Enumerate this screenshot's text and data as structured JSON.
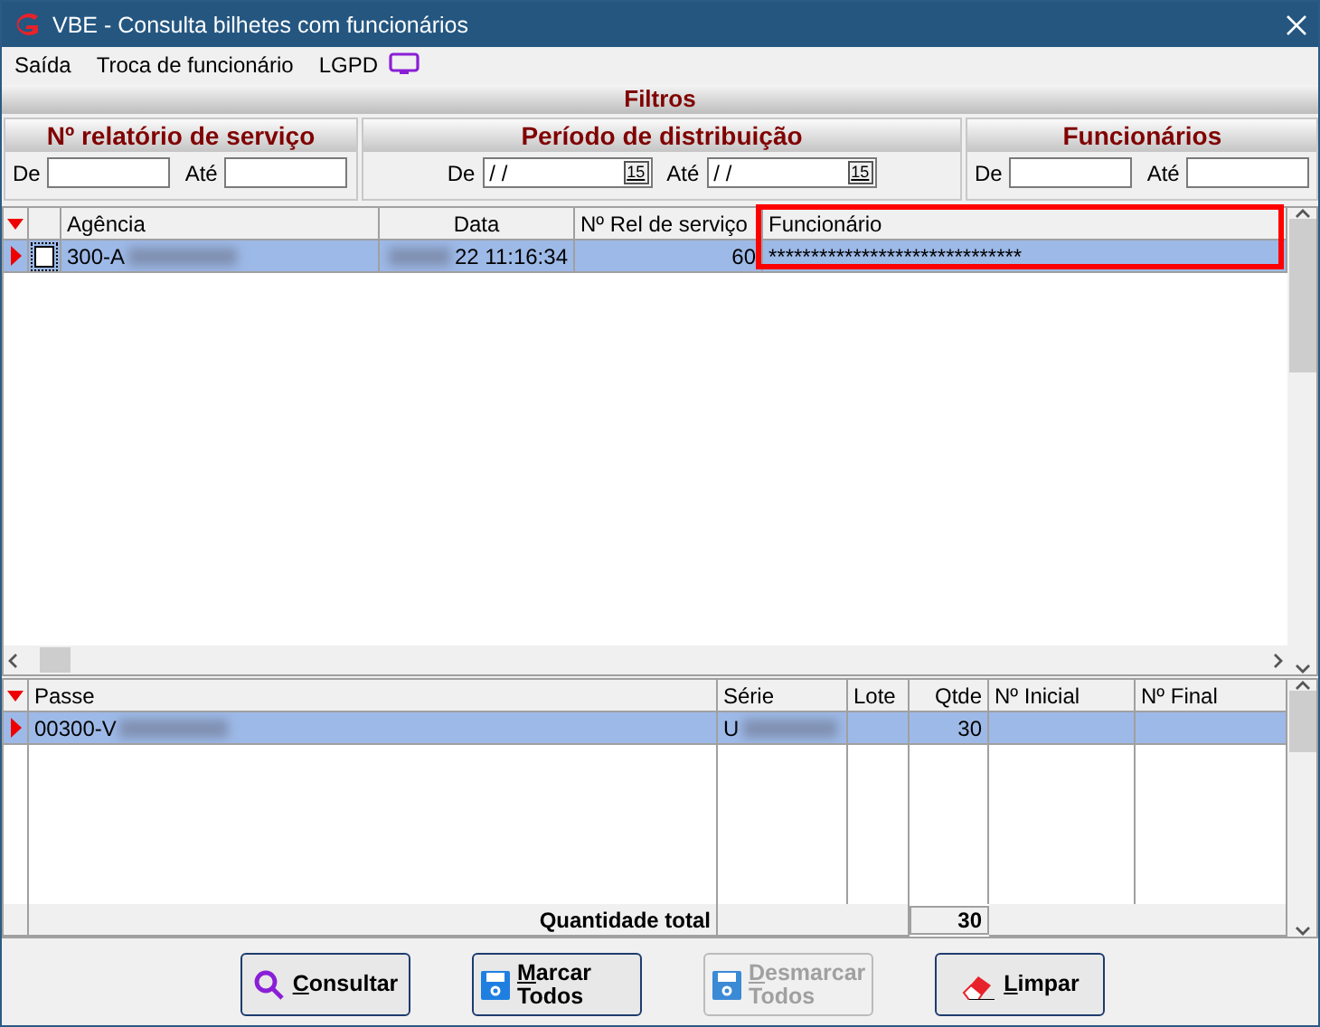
{
  "window": {
    "title": "VBE - Consulta bilhetes com funcionários"
  },
  "menu": [
    {
      "label": "Saída",
      "kind": "plain"
    },
    {
      "label": "Troca de funcionário",
      "kind": "plain"
    },
    {
      "label": "LGPD",
      "kind": "with-icon"
    }
  ],
  "filters": {
    "title": "Filtros",
    "groups": [
      {
        "title": "Nº relatório de serviço",
        "fields": [
          {
            "label": "De",
            "kind": "text"
          },
          {
            "label": "Até",
            "kind": "text"
          }
        ]
      },
      {
        "title": "Período de distribuição",
        "fields": [
          {
            "label": "De",
            "kind": "date",
            "value": " /  /",
            "button_text": "15"
          },
          {
            "label": "Até",
            "kind": "date",
            "value": " /  /",
            "button_text": "15"
          }
        ]
      },
      {
        "title": "Funcionários",
        "fields": [
          {
            "label": "De",
            "kind": "text"
          },
          {
            "label": "Até",
            "kind": "text"
          }
        ]
      }
    ]
  },
  "services_table": {
    "columns": [
      {
        "label": "Agência",
        "highlighted": false
      },
      {
        "label": "Data",
        "highlighted": false
      },
      {
        "label": "Nº Rel de serviço",
        "highlighted": false
      },
      {
        "label": "Funcionário",
        "highlighted": true
      }
    ],
    "rows": [
      {
        "selected": true,
        "checked": false,
        "cells": [
          {
            "text": "300-A",
            "blurred": true
          },
          {
            "text": "22 11:16:34",
            "blurred": true
          },
          {
            "text": "60",
            "blurred": false
          },
          {
            "text": "******************************",
            "blurred": false
          }
        ]
      }
    ]
  },
  "passes_table": {
    "columns": [
      {
        "label": "Passe"
      },
      {
        "label": "Série"
      },
      {
        "label": "Lote"
      },
      {
        "label": "Qtde"
      },
      {
        "label": "Nº Inicial"
      },
      {
        "label": "Nº Final"
      }
    ],
    "rows": [
      {
        "selected": true,
        "cells": [
          {
            "text": "00300-V",
            "blurred": true
          },
          {
            "text": "U",
            "blurred": true
          },
          null,
          {
            "text": "30",
            "blurred": false
          },
          null,
          null
        ]
      }
    ],
    "footer": {
      "label": "Quantidade total",
      "value": "30"
    }
  },
  "buttons": [
    {
      "label": "Consultar",
      "kind": "search",
      "disabled": false
    },
    {
      "label": "Marcar Todos",
      "kind": "save",
      "disabled": false
    },
    {
      "label": "Desmarcar Todos",
      "kind": "save",
      "disabled": true
    },
    {
      "label": "Limpar",
      "kind": "erase",
      "disabled": false
    }
  ]
}
